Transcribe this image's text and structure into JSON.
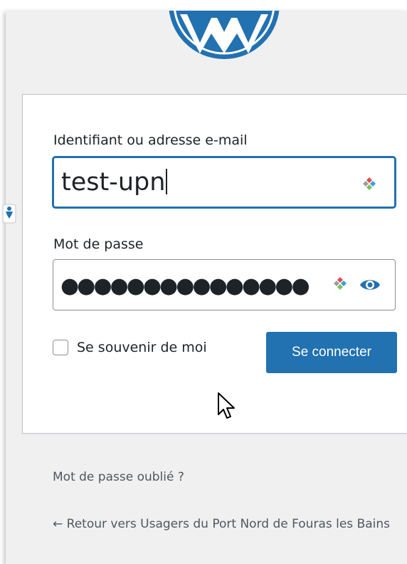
{
  "brand": {
    "logo": "wordpress-logo-icon",
    "color": "#2271b1"
  },
  "login_form": {
    "username": {
      "label": "Identifiant ou adresse e-mail",
      "value": "test-upn"
    },
    "password": {
      "label": "Mot de passe",
      "masked_value": "●●●●●●●●●●●●●●●",
      "toggle_icon": "eye-icon"
    },
    "remember": {
      "label": "Se souvenir de moi",
      "checked": false
    },
    "submit_label": "Se connecter"
  },
  "nav": {
    "lost_password": "Mot de passe oublié ?",
    "back_to_blog": "← Retour vers Usagers du Port Nord de Fouras les Bains"
  },
  "icons": {
    "field_extension": "password-manager-icon",
    "side": "accessibility-icon",
    "cursor": "mouse-pointer-icon"
  },
  "colors": {
    "primary": "#2271b1",
    "background": "#f0f0f1",
    "text": "#1d2327",
    "link": "#50575e"
  }
}
